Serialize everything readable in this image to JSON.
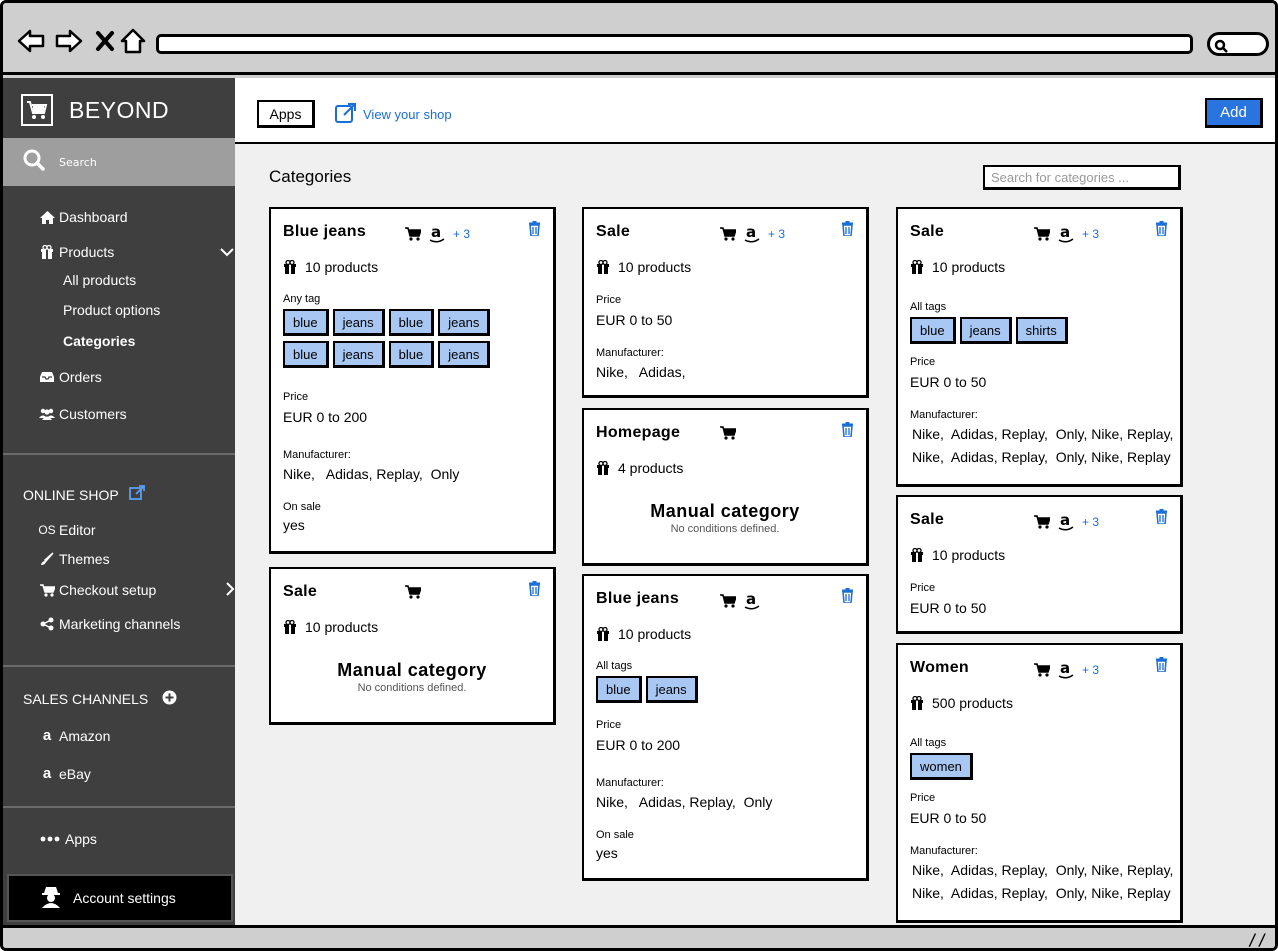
{
  "brand": {
    "name": "BEYOND"
  },
  "sidebar": {
    "search_label": "Search",
    "items": {
      "dashboard": "Dashboard",
      "products": "Products",
      "all_products": "All products",
      "product_options": "Product options",
      "categories": "Categories",
      "orders": "Orders",
      "customers": "Customers"
    },
    "online_shop": {
      "heading": "ONLINE SHOP",
      "editor": "Editor",
      "themes": "Themes",
      "checkout_setup": "Checkout setup",
      "marketing_channels": "Marketing channels"
    },
    "sales_channels": {
      "heading": "SALES CHANNELS",
      "amazon": "Amazon",
      "ebay": "eBay"
    },
    "apps": "Apps",
    "account_settings": "Account settings"
  },
  "header": {
    "apps_label": "Apps",
    "view_shop_label": "View your shop",
    "add_label": "Add"
  },
  "page": {
    "title": "Categories",
    "search_placeholder": "Search for categories ..."
  },
  "colors": {
    "accent": "#2a74e0",
    "link": "#1a6ed8",
    "tag": "#a8c7f3",
    "sidebar": "#3f3f3f"
  },
  "cards": [
    {
      "title": "Blue jeans",
      "more": "+ 3",
      "count": "10 products",
      "tags_label": "Any tag",
      "tags": [
        "blue",
        "jeans",
        "blue",
        "jeans",
        "blue",
        "jeans",
        "blue",
        "jeans"
      ],
      "price_label": "Price",
      "price": "EUR 0 to 200",
      "manufacturer_label": "Manufacturer:",
      "manufacturer": "Nike,   Adidas, Replay,  Only",
      "onsale_label": "On sale",
      "onsale": "yes"
    },
    {
      "title": "Sale",
      "count": "10 products",
      "manual_title": "Manual category",
      "manual_sub": "No conditions defined."
    },
    {
      "title": "Sale",
      "more": "+ 3",
      "count": "10 products",
      "price_label": "Price",
      "price": "EUR 0 to 50",
      "manufacturer_label": "Manufacturer:",
      "manufacturer": "Nike,   Adidas,"
    },
    {
      "title": "Homepage",
      "count": "4 products",
      "manual_title": "Manual category",
      "manual_sub": "No conditions defined."
    },
    {
      "title": "Blue jeans",
      "count": "10 products",
      "tags_label": "All tags",
      "tags": [
        "blue",
        "jeans"
      ],
      "price_label": "Price",
      "price": "EUR 0 to 200",
      "manufacturer_label": "Manufacturer:",
      "manufacturer": "Nike,   Adidas, Replay,  Only",
      "onsale_label": "On sale",
      "onsale": "yes"
    },
    {
      "title": "Sale",
      "more": "+ 3",
      "count": "10 products",
      "tags_label": "All tags",
      "tags": [
        "blue",
        "jeans",
        "shirts"
      ],
      "price_label": "Price",
      "price": "EUR 0 to 50",
      "manufacturer_label": "Manufacturer:",
      "manufacturer": "Nike,  Adidas, Replay,  Only, Nike, Replay,",
      "manufacturer2": "Nike,  Adidas, Replay,  Only, Nike, Replay"
    },
    {
      "title": "Sale",
      "more": "+ 3",
      "count": "10 products",
      "price_label": "Price",
      "price": "EUR 0 to 50"
    },
    {
      "title": "Women",
      "more": "+ 3",
      "count": "500 products",
      "tags_label": "All tags",
      "tags": [
        "women"
      ],
      "price_label": "Price",
      "price": "EUR 0 to 50",
      "manufacturer_label": "Manufacturer:",
      "manufacturer": "Nike,  Adidas, Replay,  Only, Nike, Replay,",
      "manufacturer2": "Nike,  Adidas, Replay,  Only, Nike, Replay"
    }
  ]
}
